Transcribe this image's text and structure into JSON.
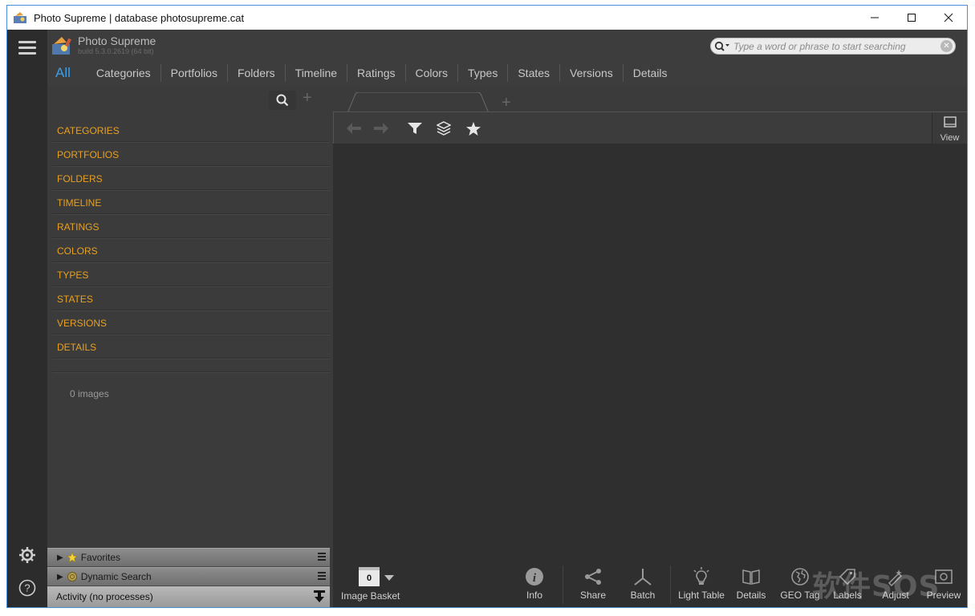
{
  "window": {
    "title": "Photo Supreme | database photosupreme.cat",
    "controls": {
      "minimize": "—",
      "maximize": "☐",
      "close": "✕"
    }
  },
  "brand": {
    "name": "Photo Supreme",
    "build": "build 5.3.0.2619 (64 bit)"
  },
  "search": {
    "placeholder": "Type a word or phrase to start searching"
  },
  "tabs": [
    {
      "label": "All",
      "active": true
    },
    {
      "label": "Categories"
    },
    {
      "label": "Portfolios"
    },
    {
      "label": "Folders"
    },
    {
      "label": "Timeline"
    },
    {
      "label": "Ratings"
    },
    {
      "label": "Colors"
    },
    {
      "label": "Types"
    },
    {
      "label": "States"
    },
    {
      "label": "Versions"
    },
    {
      "label": "Details"
    }
  ],
  "left_panel": {
    "items": [
      "CATEGORIES",
      "PORTFOLIOS",
      "FOLDERS",
      "TIMELINE",
      "RATINGS",
      "COLORS",
      "TYPES",
      "STATES",
      "VERSIONS",
      "DETAILS"
    ],
    "count": "0 images",
    "favorites": "Favorites",
    "dynamic_search": "Dynamic Search",
    "activity": "Activity (no processes)"
  },
  "main": {
    "view_label": "View"
  },
  "bottom_bar": {
    "basket_count": "0",
    "basket_label": "Image Basket",
    "items": [
      "Info",
      "Share",
      "Batch",
      "Light Table",
      "Details",
      "GEO Tag",
      "Labels",
      "Adjust",
      "Preview"
    ]
  },
  "watermark": "软件SOS",
  "colors": {
    "accent": "#3c9ee8",
    "nav_orange": "#e8a020",
    "background": "#2f2f2f"
  }
}
